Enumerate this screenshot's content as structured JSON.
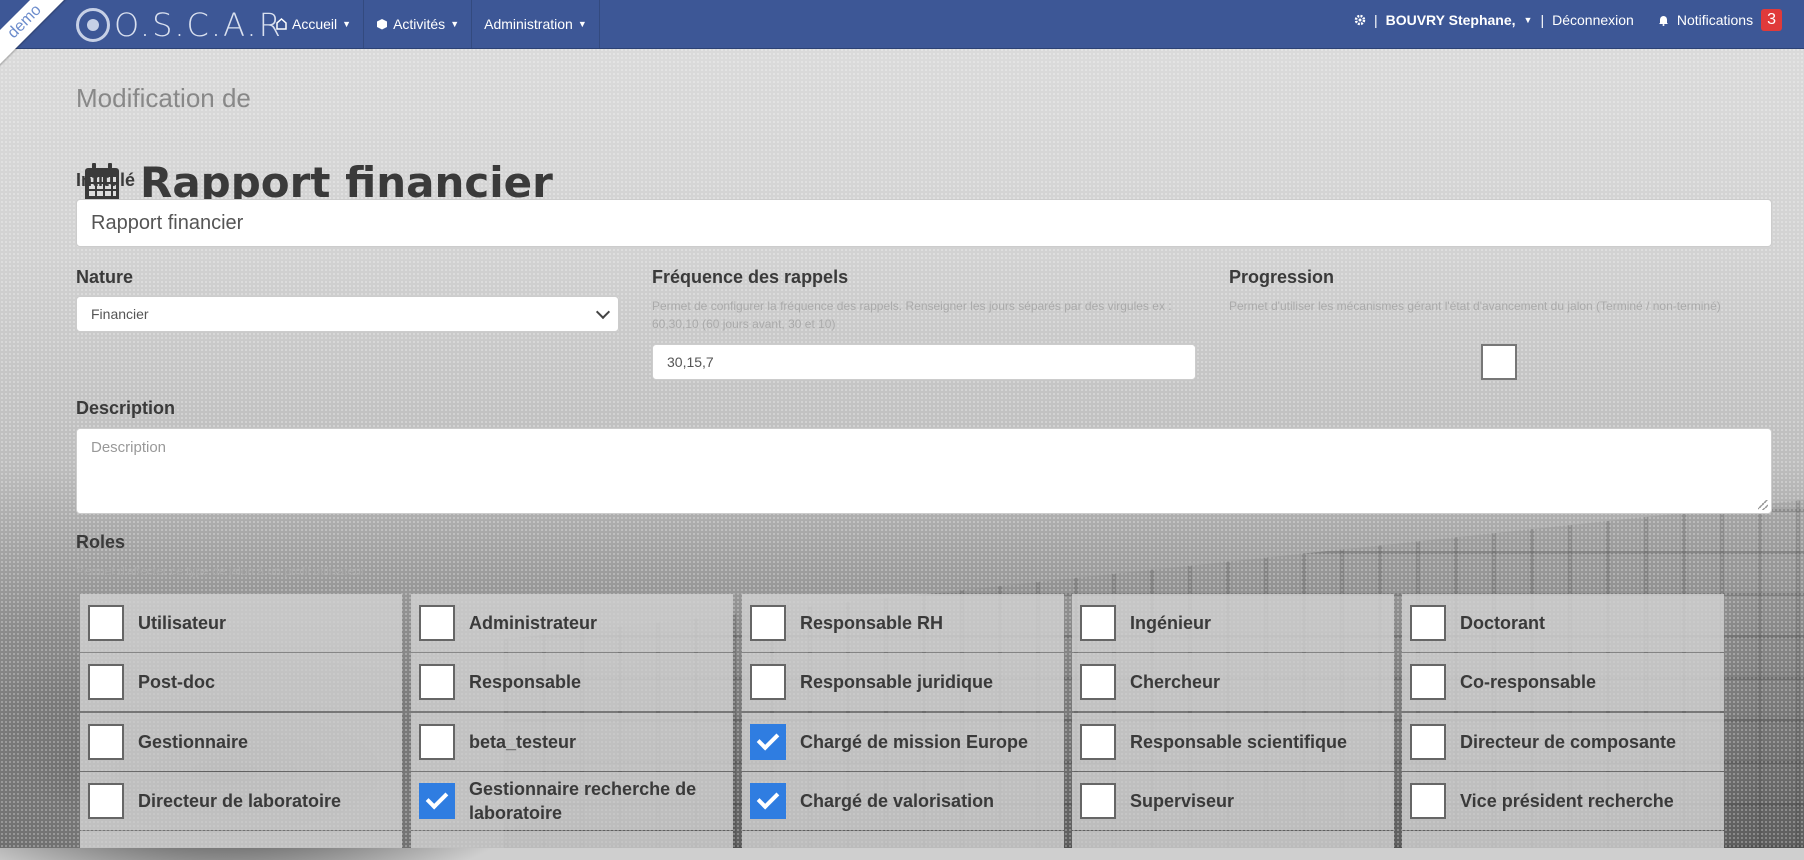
{
  "ribbon": "demo",
  "brand": {
    "name": "O.S.C.A.R"
  },
  "nav": {
    "items": [
      {
        "icon": "home-icon",
        "label": "Accueil"
      },
      {
        "icon": "cube-icon",
        "label": "Activités"
      },
      {
        "icon": "",
        "label": "Administration"
      }
    ]
  },
  "user": {
    "name": "BOUVRY Stephane,",
    "logout": "Déconnexion",
    "notifications_label": "Notifications",
    "notifications_count": "3",
    "separator": "|"
  },
  "page": {
    "subtitle": "Modification de",
    "title": "Rapport financier"
  },
  "form": {
    "intitule_label": "Intitulé",
    "intitule_value": "Rapport financier",
    "nature_label": "Nature",
    "nature_value": "Financier",
    "frequence_label": "Fréquence des rappels",
    "frequence_help": "Permet de configurer la fréquence des rappels. Renseigner les jours séparés par des virgules ex : 60,30,10 (60 jours avant, 30 et 10)",
    "frequence_value": "30,15,7",
    "progression_label": "Progression",
    "progression_help": "Permet d'utiliser les mécanismes gérant l'état d'avancement du jalon (Terminé / non-terminé)",
    "progression_checked": false,
    "description_label": "Description",
    "description_placeholder": "Description",
    "roles_label": "Roles",
    "roles_help": "Permet d'affecter ce type de jalon à un profil utilisateur"
  },
  "roles": [
    {
      "label": "Utilisateur",
      "checked": false
    },
    {
      "label": "Administrateur",
      "checked": false
    },
    {
      "label": "Responsable RH",
      "checked": false
    },
    {
      "label": "Ingénieur",
      "checked": false
    },
    {
      "label": "Doctorant",
      "checked": false
    },
    {
      "label": "Post-doc",
      "checked": false
    },
    {
      "label": "Responsable",
      "checked": false
    },
    {
      "label": "Responsable juridique",
      "checked": false
    },
    {
      "label": "Chercheur",
      "checked": false
    },
    {
      "label": "Co-responsable",
      "checked": false
    },
    {
      "label": "Gestionnaire",
      "checked": false
    },
    {
      "label": "beta_testeur",
      "checked": false
    },
    {
      "label": "Chargé de mission Europe",
      "checked": true
    },
    {
      "label": "Responsable scientifique",
      "checked": false
    },
    {
      "label": "Directeur de composante",
      "checked": false
    },
    {
      "label": "Directeur de laboratoire",
      "checked": false
    },
    {
      "label": "Gestionnaire recherche de laboratoire",
      "checked": true
    },
    {
      "label": "Chargé de valorisation",
      "checked": true
    },
    {
      "label": "Superviseur",
      "checked": false
    },
    {
      "label": "Vice président recherche",
      "checked": false
    }
  ],
  "colors": {
    "navbar": "#3d5796",
    "accent": "#2f7de1",
    "badge": "#e03a3a"
  }
}
